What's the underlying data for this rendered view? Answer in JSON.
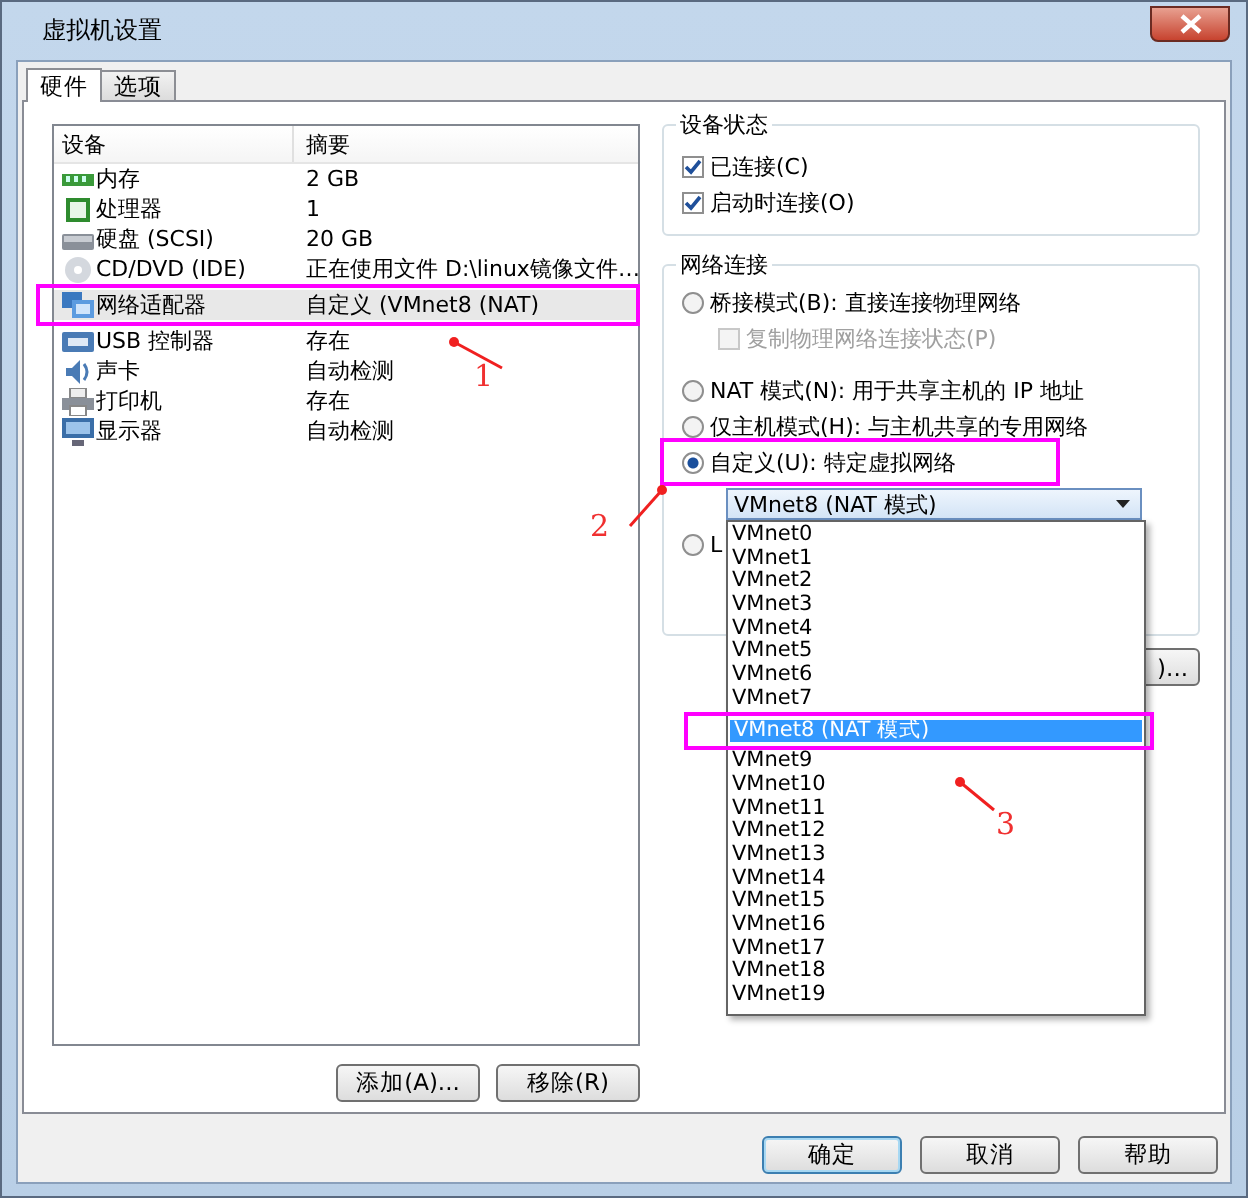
{
  "window": {
    "title": "虚拟机设置"
  },
  "tabs": [
    {
      "label": "硬件",
      "selected": true
    },
    {
      "label": "选项",
      "selected": false
    }
  ],
  "device_list": {
    "columns": [
      "设备",
      "摘要"
    ],
    "rows": [
      {
        "kind": "memory",
        "device": "内存",
        "summary": "2 GB",
        "selected": false
      },
      {
        "kind": "cpu",
        "device": "处理器",
        "summary": "1",
        "selected": false
      },
      {
        "kind": "disk",
        "device": "硬盘 (SCSI)",
        "summary": "20 GB",
        "selected": false
      },
      {
        "kind": "cd",
        "device": "CD/DVD (IDE)",
        "summary": "正在使用文件 D:\\linux镜像文件…",
        "selected": false
      },
      {
        "kind": "network",
        "device": "网络适配器",
        "summary": "自定义 (VMnet8 (NAT)",
        "selected": true
      },
      {
        "kind": "usb",
        "device": "USB 控制器",
        "summary": "存在",
        "selected": false
      },
      {
        "kind": "sound",
        "device": "声卡",
        "summary": "自动检测",
        "selected": false
      },
      {
        "kind": "printer",
        "device": "打印机",
        "summary": "存在",
        "selected": false
      },
      {
        "kind": "display",
        "device": "显示器",
        "summary": "自动检测",
        "selected": false
      }
    ]
  },
  "device_buttons": [
    "添加(A)...",
    "移除(R)"
  ],
  "device_status": {
    "title": "设备状态",
    "options": [
      {
        "label": "已连接(C)",
        "checked": true
      },
      {
        "label": "启动时连接(O)",
        "checked": true
      }
    ]
  },
  "network": {
    "title": "网络连接",
    "options": [
      {
        "kind": "radio",
        "label": "桥接模式(B): 直接连接物理网络",
        "selected": false
      },
      {
        "kind": "checkbox",
        "label": "复制物理网络连接状态(P)",
        "checked": false,
        "disabled": true
      },
      {
        "kind": "radio",
        "label": "NAT 模式(N): 用于共享主机的 IP 地址",
        "selected": false
      },
      {
        "kind": "radio",
        "label": "仅主机模式(H): 与主机共享的专用网络",
        "selected": false
      },
      {
        "kind": "radio",
        "label": "自定义(U): 特定虚拟网络",
        "selected": true
      },
      {
        "kind": "dropdown",
        "value": "VMnet8 (NAT 模式)",
        "expanded": true
      },
      {
        "kind": "radio",
        "label": "L",
        "selected": false
      }
    ],
    "button_label": ")..."
  },
  "dropdown_options": [
    {
      "label": "VMnet0",
      "selected": false
    },
    {
      "label": "VMnet1",
      "selected": false
    },
    {
      "label": "VMnet2",
      "selected": false
    },
    {
      "label": "VMnet3",
      "selected": false
    },
    {
      "label": "VMnet4",
      "selected": false
    },
    {
      "label": "VMnet5",
      "selected": false
    },
    {
      "label": "VMnet6",
      "selected": false
    },
    {
      "label": "VMnet7",
      "selected": false
    },
    {
      "label": "VMnet8 (NAT 模式)",
      "selected": true
    },
    {
      "label": "VMnet9",
      "selected": false
    },
    {
      "label": "VMnet10",
      "selected": false
    },
    {
      "label": "VMnet11",
      "selected": false
    },
    {
      "label": "VMnet12",
      "selected": false
    },
    {
      "label": "VMnet13",
      "selected": false
    },
    {
      "label": "VMnet14",
      "selected": false
    },
    {
      "label": "VMnet15",
      "selected": false
    },
    {
      "label": "VMnet16",
      "selected": false
    },
    {
      "label": "VMnet17",
      "selected": false
    },
    {
      "label": "VMnet18",
      "selected": false
    },
    {
      "label": "VMnet19",
      "selected": false
    }
  ],
  "footer_buttons": [
    "确定",
    "取消",
    "帮助"
  ],
  "annotations": [
    {
      "label": "1"
    },
    {
      "label": "2"
    },
    {
      "label": "3"
    }
  ]
}
